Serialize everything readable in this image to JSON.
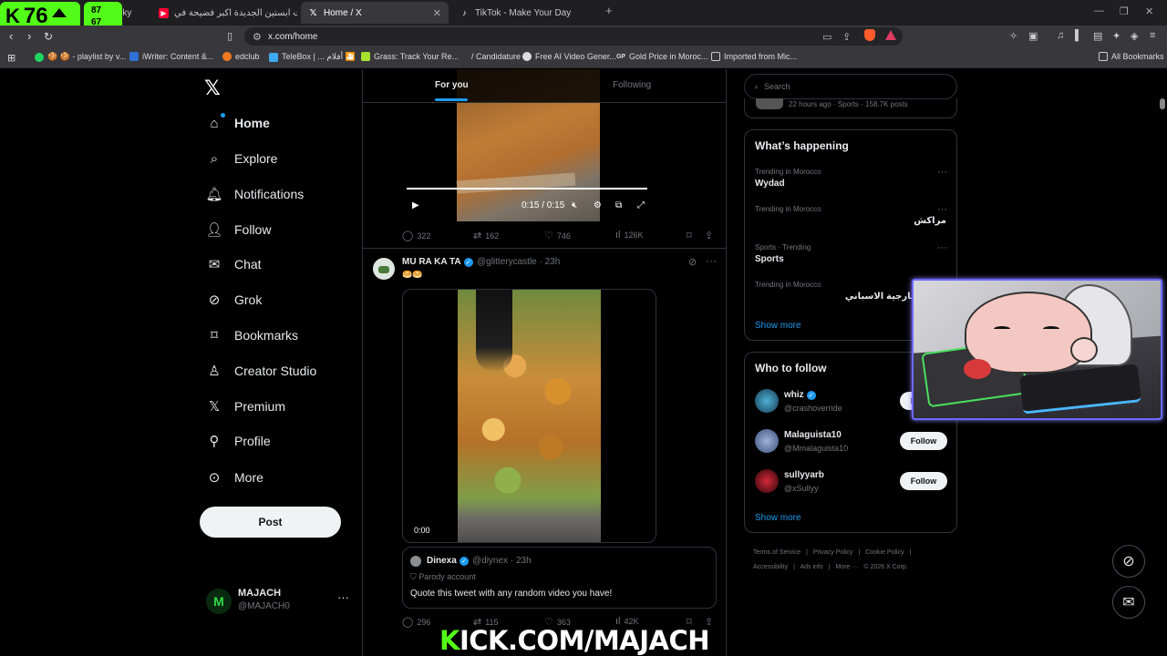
{
  "overlay": {
    "kick_logo": "K",
    "follower_count": "76",
    "stat_top": "87",
    "stat_bottom": "67",
    "banner_prefix": "K",
    "banner_rest": "ICK.COM/MAJACH",
    "accent": "#53fc18"
  },
  "browser": {
    "tabs": [
      {
        "label": "ver Sky",
        "icon": "generic-tab-icon"
      },
      {
        "label": "ملفات ابستين الجديدة اكبر فضيحة في",
        "icon": "youtube-icon"
      },
      {
        "label": "Home / X",
        "icon": "x-icon",
        "active": true
      },
      {
        "label": "TikTok - Make Your Day",
        "icon": "tiktok-icon"
      }
    ],
    "new_tab": "+",
    "url": "x.com/home",
    "bookmarks": [
      {
        "label": "🍪 🍪 - playlist by v...",
        "icon": "spotify-icon"
      },
      {
        "label": "iWriter: Content &...",
        "icon": "iwriter-icon"
      },
      {
        "label": "edclub",
        "icon": "edclub-icon"
      },
      {
        "label": "TeleBox | ... أفلام 🎦",
        "icon": "telebox-icon"
      },
      {
        "label": "Grass: Track Your Re...",
        "icon": "grass-icon"
      },
      {
        "label": "/ Candidature",
        "icon": "blank-icon"
      },
      {
        "label": "Free AI Video Gener...",
        "icon": "ai-icon"
      },
      {
        "label": "Gold Price in Moroc...",
        "icon": "gp-icon"
      },
      {
        "label": "Imported from Mic...",
        "icon": "folder-icon"
      }
    ],
    "all_bookmarks": "All Bookmarks"
  },
  "nav": {
    "items": [
      {
        "label": "Home",
        "icon": "home-icon"
      },
      {
        "label": "Explore",
        "icon": "search-icon"
      },
      {
        "label": "Notifications",
        "icon": "bell-icon"
      },
      {
        "label": "Follow",
        "icon": "follow-icon"
      },
      {
        "label": "Chat",
        "icon": "mail-icon"
      },
      {
        "label": "Grok",
        "icon": "grok-icon"
      },
      {
        "label": "Bookmarks",
        "icon": "bookmark-icon"
      },
      {
        "label": "Creator Studio",
        "icon": "creator-studio-icon"
      },
      {
        "label": "Premium",
        "icon": "x-premium-icon"
      },
      {
        "label": "Profile",
        "icon": "profile-icon"
      },
      {
        "label": "More",
        "icon": "more-circle-icon"
      }
    ],
    "post_label": "Post",
    "account": {
      "name": "MAJACH",
      "handle": "@MAJACH0",
      "avatar_letter": "M"
    }
  },
  "timeline": {
    "tabs": [
      "For you",
      "Following"
    ],
    "tweet1": {
      "video_time": "0:15 / 0:15",
      "video_progress": 1.0,
      "stats": {
        "replies": "322",
        "reposts": "162",
        "likes": "746",
        "views": "126K"
      }
    },
    "tweet2": {
      "name": "MU RA KA TA",
      "handle": "@glitterycastle · 23h",
      "text": "🥯🥯",
      "video_time": "0:00",
      "quote": {
        "name": "Dinexa",
        "handle": "@diynex · 23h",
        "badge": "Parody account",
        "text": "Quote this tweet with any random video you have!"
      },
      "stats": {
        "replies": "296",
        "reposts": "115",
        "likes": "363",
        "views": "42K"
      }
    }
  },
  "right": {
    "search_placeholder": "Search",
    "peek_text": "22 hours ago · Sports · 158.7K posts",
    "happening": {
      "title": "What’s happening",
      "trends": [
        {
          "meta": "Trending in Morocco",
          "name": "Wydad",
          "rtl": false
        },
        {
          "meta": "Trending in Morocco",
          "name": "مراكش",
          "rtl": true
        },
        {
          "meta": "Sports · Trending",
          "name": "Sports",
          "rtl": false
        },
        {
          "meta": "Trending in Morocco",
          "name": "وزير الخارجية الاسباني",
          "rtl": true
        }
      ],
      "show_more": "Show more"
    },
    "who_to_follow": {
      "title": "Who to follow",
      "users": [
        {
          "name": "whiz",
          "handle": "@crashoverride",
          "verified": true,
          "button": "Follow"
        },
        {
          "name": "Malaguista10",
          "handle": "@Mmalaguista10",
          "verified": false,
          "button": "Follow"
        },
        {
          "name": "sullyyarb",
          "handle": "@xSullyy",
          "verified": false,
          "button": "Follow"
        }
      ],
      "show_more": "Show more"
    },
    "footer": [
      "Terms of Service",
      "|",
      "Privacy Policy",
      "|",
      "Cookie Policy",
      "|",
      "Accessibility",
      "|",
      "Ads info",
      "|",
      "More ···",
      "© 2026 X Corp."
    ]
  }
}
